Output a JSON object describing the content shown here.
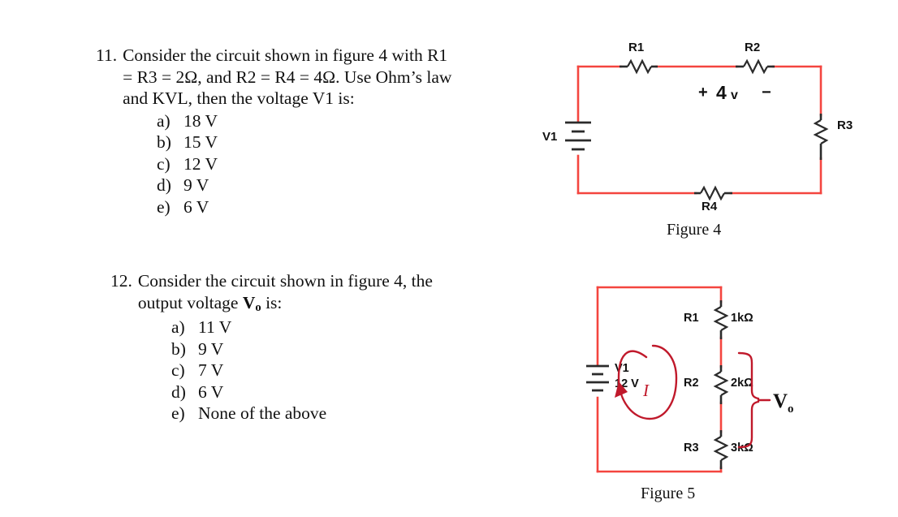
{
  "document": {
    "type": "exam-questions-circuit-analysis"
  },
  "questions": [
    {
      "number": "11.",
      "lines": [
        "Consider the circuit shown in figure 4 with R1",
        "= R3 = 2Ω, and R2 = R4 = 4Ω. Use Ohm’s law",
        "and KVL, then the voltage V1 is:"
      ],
      "choices": [
        {
          "letter": "a)",
          "text": "18 V"
        },
        {
          "letter": "b)",
          "text": "15 V"
        },
        {
          "letter": "c)",
          "text": "12 V"
        },
        {
          "letter": "d)",
          "text": "9 V"
        },
        {
          "letter": "e)",
          "text": "6 V"
        }
      ]
    },
    {
      "number": "12.",
      "lines": [
        "Consider the circuit shown in figure 4, the",
        "output voltage Vₒ is:"
      ],
      "line2_prefix": "output voltage ",
      "line2_var": "V",
      "line2_sub": "o",
      "line2_suffix": " is:",
      "choices": [
        {
          "letter": "a)",
          "text": "11 V"
        },
        {
          "letter": "b)",
          "text": "9 V"
        },
        {
          "letter": "c)",
          "text": "7 V"
        },
        {
          "letter": "d)",
          "text": "6 V"
        },
        {
          "letter": "e)",
          "text": "None of the above"
        }
      ]
    }
  ],
  "figure4": {
    "caption": "Figure 4",
    "source_label": "V1",
    "resistors": [
      {
        "name": "R1",
        "position": "top-left"
      },
      {
        "name": "R2",
        "position": "top-right"
      },
      {
        "name": "R3",
        "position": "right"
      },
      {
        "name": "R4",
        "position": "bottom"
      }
    ],
    "annotation": {
      "plus": "+",
      "value": "4",
      "unit": "v",
      "minus": "−"
    }
  },
  "figure5": {
    "caption": "Figure 5",
    "source_label": "V1",
    "source_value": "12 V",
    "current_label": "I",
    "output_label": "V",
    "output_sub": "o",
    "resistors": [
      {
        "name": "R1",
        "value": "1kΩ"
      },
      {
        "name": "R2",
        "value": "2kΩ"
      },
      {
        "name": "R3",
        "value": "3kΩ"
      }
    ]
  },
  "colors": {
    "wire_red": "#f4453f",
    "component_dark": "#2b2b2b",
    "annotation_red": "#c0192b",
    "text_black": "#111111",
    "background": "#ffffff"
  }
}
